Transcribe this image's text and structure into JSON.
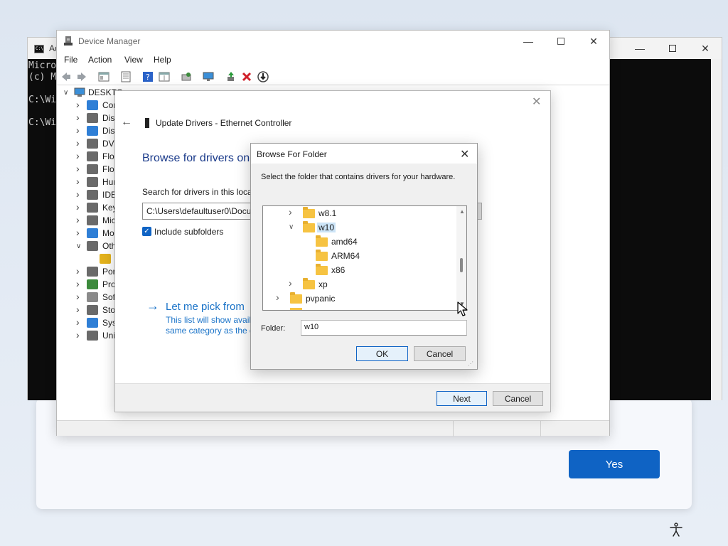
{
  "cmd": {
    "title": "Ad",
    "lines": [
      "Micro",
      "(c) M",
      "",
      "C:\\Wi",
      "",
      "C:\\Wi"
    ],
    "icon_text": "C:\\"
  },
  "device_manager": {
    "title": "Device Manager",
    "menu": [
      "File",
      "Action",
      "View",
      "Help"
    ],
    "tree": {
      "root": "DESKTO",
      "items": [
        {
          "label": "Cor",
          "expanded": false,
          "icon_color": "#2f7fd6"
        },
        {
          "label": "Disk",
          "expanded": false,
          "icon_color": "#6a6a6a"
        },
        {
          "label": "Disp",
          "expanded": false,
          "icon_color": "#2f7fd6"
        },
        {
          "label": "DVD",
          "expanded": false,
          "icon_color": "#6a6a6a"
        },
        {
          "label": "Flop",
          "expanded": false,
          "icon_color": "#6a6a6a"
        },
        {
          "label": "Flop",
          "expanded": false,
          "icon_color": "#6a6a6a"
        },
        {
          "label": "Hun",
          "expanded": false,
          "icon_color": "#6a6a6a"
        },
        {
          "label": "IDE",
          "expanded": false,
          "icon_color": "#6a6a6a"
        },
        {
          "label": "Key",
          "expanded": false,
          "icon_color": "#6a6a6a"
        },
        {
          "label": "Mic",
          "expanded": false,
          "icon_color": "#6a6a6a"
        },
        {
          "label": "Mo",
          "expanded": false,
          "icon_color": "#2f7fd6"
        },
        {
          "label": "Oth",
          "expanded": true,
          "icon_color": "#6a6a6a"
        },
        {
          "label": "",
          "expanded": null,
          "icon_color": "#e3b21c"
        },
        {
          "label": "Por",
          "expanded": false,
          "icon_color": "#6a6a6a"
        },
        {
          "label": "Pro",
          "expanded": false,
          "icon_color": "#3c8a3c"
        },
        {
          "label": "Soft",
          "expanded": false,
          "icon_color": "#8a8a8a"
        },
        {
          "label": "Stor",
          "expanded": false,
          "icon_color": "#6a6a6a"
        },
        {
          "label": "Syst",
          "expanded": false,
          "icon_color": "#2f7fd6"
        },
        {
          "label": "Uni",
          "expanded": false,
          "icon_color": "#6a6a6a"
        }
      ]
    }
  },
  "wizard": {
    "title": "Update Drivers - Ethernet Controller",
    "heading": "Browse for drivers on",
    "search_label": "Search for drivers in this locat",
    "path": "C:\\Users\\defaultuser0\\Docu",
    "include_subfolders_label": "Include subfolders",
    "include_subfolders_checked": true,
    "pick_link": "Let me pick from",
    "pick_desc_1": "This list will show avail",
    "pick_desc_2": "same category as the d",
    "next_label": "Next",
    "cancel_label": "Cancel"
  },
  "browse_folder": {
    "title": "Browse For Folder",
    "instruction": "Select the folder that contains drivers for your hardware.",
    "folders": [
      {
        "label": "w8.1",
        "level": 2,
        "chevron": "collapsed",
        "selected": false
      },
      {
        "label": "w10",
        "level": 2,
        "chevron": "expanded",
        "selected": true
      },
      {
        "label": "amd64",
        "level": 3,
        "chevron": "none",
        "selected": false
      },
      {
        "label": "ARM64",
        "level": 3,
        "chevron": "none",
        "selected": false
      },
      {
        "label": "x86",
        "level": 3,
        "chevron": "none",
        "selected": false
      },
      {
        "label": "xp",
        "level": 2,
        "chevron": "collapsed",
        "selected": false
      },
      {
        "label": "pvpanic",
        "level": 1,
        "chevron": "collapsed",
        "selected": false
      }
    ],
    "folder_label": "Folder:",
    "folder_value": "w10",
    "ok_label": "OK",
    "cancel_label": "Cancel"
  },
  "oobe": {
    "yes_label": "Yes",
    "accent": "#0f63c4"
  }
}
